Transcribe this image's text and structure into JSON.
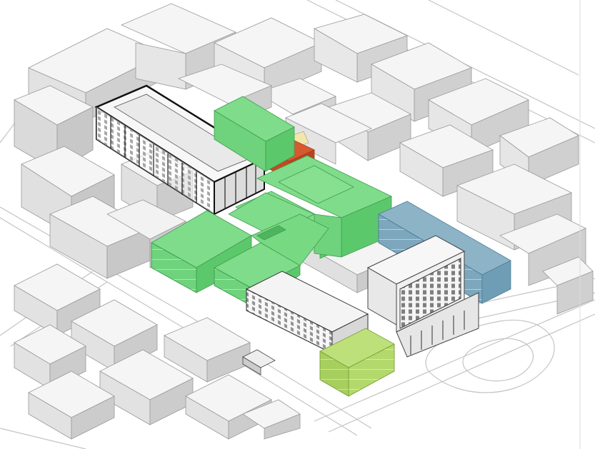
{
  "scene": {
    "kind": "isometric-massing-model",
    "colors": {
      "background": "#ffffff",
      "context_fill": "#f3f3f3",
      "context_shade": "#d6d6d6",
      "context_stroke": "#9a9a9a",
      "road_line": "#bdbdbd",
      "proposal_green_top": "#7fdc8a",
      "proposal_green_side": "#5cc86c",
      "proposal_green_front": "#6fd27c",
      "proposal_red_top": "#d65a30",
      "proposal_red_side": "#c24a22",
      "proposal_blue_top": "#8db3c7",
      "proposal_blue_side": "#6f9db5",
      "proposal_lime_top": "#bde07a",
      "proposal_lime_side": "#a6cf5e",
      "proposal_yellow": "#f2e7a8",
      "heritage_outline": "#222222",
      "window_dark": "#333333"
    }
  }
}
